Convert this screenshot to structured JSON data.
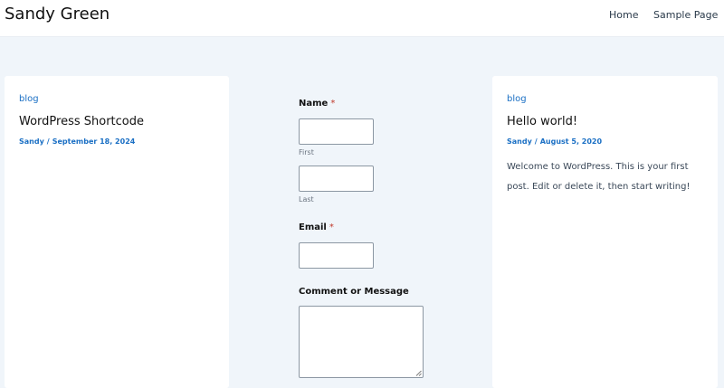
{
  "header": {
    "site_title": "Sandy Green",
    "nav": [
      {
        "label": "Home"
      },
      {
        "label": "Sample Page"
      }
    ]
  },
  "left_post": {
    "category": "blog",
    "title": "WordPress Shortcode",
    "author": "Sandy",
    "separator": "/",
    "date": "September 18, 2024"
  },
  "form": {
    "name_label": "Name",
    "email_label": "Email",
    "required_marker": "*",
    "first_sublabel": "First",
    "last_sublabel": "Last",
    "comment_label": "Comment or Message",
    "first_value": "",
    "last_value": "",
    "email_value": "",
    "comment_value": ""
  },
  "right_post": {
    "category": "blog",
    "title": "Hello world!",
    "author": "Sandy",
    "separator": "/",
    "date": "August 5, 2020",
    "excerpt": "Welcome to WordPress. This is your first post. Edit or delete it, then start writing!"
  },
  "colors": {
    "accent_link": "#1a6fc4",
    "page_background": "#f0f5fa",
    "required": "#c0392b"
  }
}
